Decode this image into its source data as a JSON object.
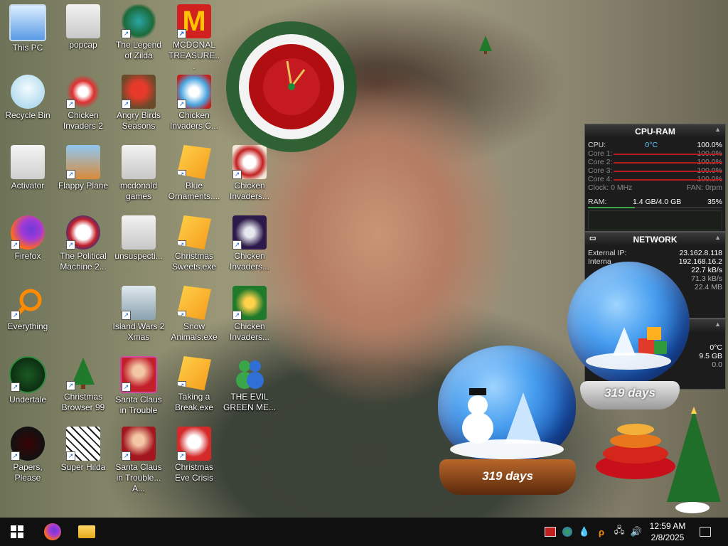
{
  "desktop": {
    "icons": [
      {
        "label": "This PC",
        "icon": "this-pc-icon"
      },
      {
        "label": "popcap",
        "icon": "folder-icon"
      },
      {
        "label": "The Legend of Zilda",
        "icon": "game-icon"
      },
      {
        "label": "MCDONAL TREASURE...",
        "icon": "mcdonalds-icon"
      },
      {
        "label": "Recycle Bin",
        "icon": "recycle-bin-icon"
      },
      {
        "label": "Chicken Invaders 2",
        "icon": "chicken-icon"
      },
      {
        "label": "Angry Birds Seasons",
        "icon": "angry-birds-icon"
      },
      {
        "label": "Chicken Invaders C...",
        "icon": "chicken-icon"
      },
      {
        "label": "Activator",
        "icon": "folder-icon"
      },
      {
        "label": "Flappy Plane",
        "icon": "game-icon"
      },
      {
        "label": "mcdonald games",
        "icon": "folder-icon"
      },
      {
        "label": "Blue Ornaments....",
        "icon": "exe-icon"
      },
      {
        "label": "Chicken Invaders...",
        "icon": "chicken-icon"
      },
      {
        "label": "Firefox",
        "icon": "firefox-icon"
      },
      {
        "label": "The Political Machine 2...",
        "icon": "political-machine-icon"
      },
      {
        "label": "unsuspecti...",
        "icon": "folder-icon"
      },
      {
        "label": "Christmas Sweets.exe",
        "icon": "exe-icon"
      },
      {
        "label": "Chicken Invaders...",
        "icon": "chicken-icon"
      },
      {
        "label": "Everything",
        "icon": "search-icon"
      },
      {
        "label": "Island Wars 2 Xmas",
        "icon": "game-icon"
      },
      {
        "label": "Snow Animals.exe",
        "icon": "exe-icon"
      },
      {
        "label": "Chicken Invaders...",
        "icon": "chicken-icon"
      },
      {
        "label": "Undertale",
        "icon": "undertale-icon"
      },
      {
        "label": "Christmas Browser 99",
        "icon": "christmas-tree-icon"
      },
      {
        "label": "Santa Claus in Trouble",
        "icon": "santa-icon"
      },
      {
        "label": "Taking a Break.exe",
        "icon": "exe-icon"
      },
      {
        "label": "THE EVIL GREEN ME...",
        "icon": "messenger-icon"
      },
      {
        "label": "Papers, Please",
        "icon": "papers-please-icon"
      },
      {
        "label": "Super Hilda",
        "icon": "game-icon"
      },
      {
        "label": "Santa Claus in Trouble... A...",
        "icon": "santa-icon"
      },
      {
        "label": "Christmas Eve Crisis",
        "icon": "santa-icon"
      }
    ]
  },
  "cpu_ram": {
    "title": "CPU-RAM",
    "cpu_label": "CPU:",
    "cpu_temp": "0°C",
    "cpu_value": "100.0%",
    "cores": [
      {
        "label": "Core 1:",
        "value": "100.0%"
      },
      {
        "label": "Core 2:",
        "value": "100.0%"
      },
      {
        "label": "Core 3:",
        "value": "100.0%"
      },
      {
        "label": "Core 4:",
        "value": "100.0%"
      }
    ],
    "clock": "Clock: 0 MHz",
    "fan": "FAN: 0rpm",
    "ram_label": "RAM:",
    "ram_value": "1.4 GB/4.0 GB",
    "ram_pct": "35%"
  },
  "network": {
    "title": "NETWORK",
    "external_ip_label": "External IP:",
    "external_ip": "23.162.8.118",
    "internal_ip_label": "Interna",
    "internal_ip": "192.168.16.2",
    "speed1": "22.7 kB/s",
    "speed2": "71.3 kB/s",
    "total": "22.4 MB"
  },
  "third_gadget": {
    "temp": "0°C",
    "value": "9.5 GB",
    "value2": "0.0"
  },
  "globes": {
    "large_days": "319 days",
    "small_days": "319 days"
  },
  "taskbar": {
    "time": "12:59 AM",
    "date": "2/8/2025"
  }
}
